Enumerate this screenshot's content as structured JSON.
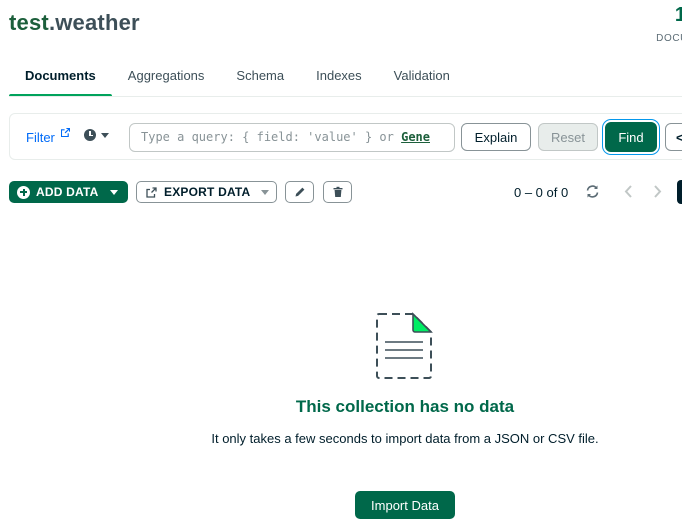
{
  "header": {
    "db_name": "test",
    "separator": ".",
    "collection_name": "weather",
    "doc_count": "1",
    "doc_label": "DOCU"
  },
  "tabs": [
    {
      "label": "Documents",
      "active": true
    },
    {
      "label": "Aggregations",
      "active": false
    },
    {
      "label": "Schema",
      "active": false
    },
    {
      "label": "Indexes",
      "active": false
    },
    {
      "label": "Validation",
      "active": false
    }
  ],
  "query_bar": {
    "filter_label": "Filter",
    "placeholder": "Type a query: { field: 'value' } or ",
    "generate_link": "Gene",
    "explain_label": "Explain",
    "reset_label": "Reset",
    "find_label": "Find",
    "more_label": "<"
  },
  "toolbar": {
    "add_data_label": "ADD DATA",
    "export_data_label": "EXPORT DATA",
    "pagination_text": "0 – 0 of 0"
  },
  "empty_state": {
    "title": "This collection has no data",
    "description": "It only takes a few seconds to import data from a JSON or CSV file.",
    "import_button": "Import Data"
  },
  "colors": {
    "brand_green": "#00684a",
    "accent_green": "#00a35c",
    "link_blue": "#016bf8",
    "text_dark": "#001e2b"
  }
}
